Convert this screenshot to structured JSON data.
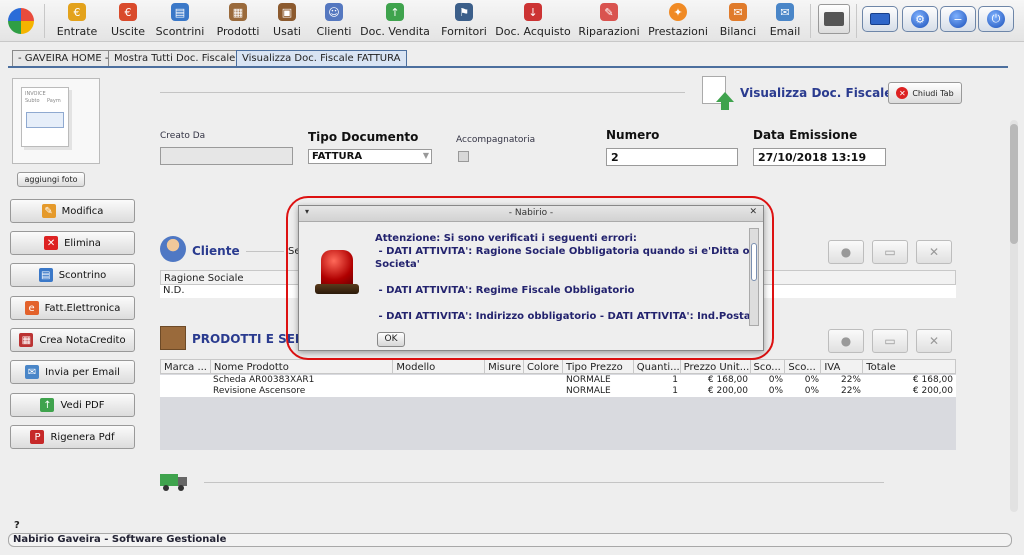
{
  "toolbar": {
    "items": [
      {
        "label": "Entrate"
      },
      {
        "label": "Uscite"
      },
      {
        "label": "Scontrini"
      },
      {
        "label": "Prodotti"
      },
      {
        "label": "Usati"
      },
      {
        "label": "Clienti"
      },
      {
        "label": "Doc. Vendita"
      },
      {
        "label": "Fornitori"
      },
      {
        "label": "Doc. Acquisto"
      },
      {
        "label": "Riparazioni"
      },
      {
        "label": "Prestazioni"
      },
      {
        "label": "Bilanci"
      },
      {
        "label": "Email"
      }
    ],
    "right_buttons": [
      {
        "icon": "keyboard-icon"
      },
      {
        "icon": "settings-icon"
      },
      {
        "icon": "minimize-icon"
      },
      {
        "icon": "power-icon"
      }
    ]
  },
  "tabs": [
    {
      "label": "- GAVEIRA HOME -"
    },
    {
      "label": "Mostra Tutti Doc. Fiscale"
    },
    {
      "label": "Visualizza Doc. Fiscale FATTURA"
    }
  ],
  "header": {
    "title": "Visualizza Doc. Fiscale",
    "close_tab": "Chiudi Tab"
  },
  "photo": {
    "button": "aggiungi foto",
    "doc_lines": [
      "INVOICE",
      "Subto",
      "Paym"
    ]
  },
  "side_buttons": [
    {
      "label": "Modifica"
    },
    {
      "label": "Elimina"
    },
    {
      "label": "Scontrino"
    },
    {
      "label": "Fatt.Elettronica"
    },
    {
      "label": "Crea NotaCredito"
    },
    {
      "label": "Invia per Email"
    },
    {
      "label": "Vedi PDF"
    },
    {
      "label": "Rigenera Pdf"
    }
  ],
  "form": {
    "creato_da_label": "Creato Da",
    "creato_da_value": "",
    "tipo_label": "Tipo Documento",
    "tipo_value": "FATTURA",
    "accompagnatoria_label": "Accompagnatoria",
    "numero_label": "Numero",
    "numero_value": "2",
    "data_label": "Data Emissione",
    "data_value": "27/10/2018 13:19"
  },
  "cliente": {
    "title": "Cliente",
    "partial_label": "Se",
    "columns": [
      "Ragione Sociale"
    ],
    "rows": [
      [
        "N.D."
      ]
    ]
  },
  "prodotti": {
    "title": "PRODOTTI E SERVI",
    "columns": [
      "Marca ...",
      "Nome Prodotto",
      "Modello",
      "Misure",
      "Colore",
      "Tipo Prezzo",
      "Quanti...",
      "Prezzo Unit...",
      "Sco...",
      "Sco...",
      "IVA",
      "Totale"
    ],
    "rows": [
      [
        "",
        "Scheda AR00383XAR1",
        "",
        "",
        "",
        "NORMALE",
        "1",
        "€ 168,00",
        "0%",
        "0%",
        "22%",
        "€ 168,00"
      ],
      [
        "",
        "Revisione Ascensore",
        "",
        "",
        "",
        "NORMALE",
        "1",
        "€ 200,00",
        "0%",
        "0%",
        "22%",
        "€ 200,00"
      ]
    ]
  },
  "dialog": {
    "title": "- Nabirio -",
    "lines": [
      "Attenzione: Si sono verificati i seguenti errori:",
      " - DATI ATTIVITA': Ragione Sociale Obbligatoria quando si e'Ditta o",
      "Societa'",
      "",
      " - DATI ATTIVITA': Regime Fiscale Obbligatorio",
      "",
      " - DATI ATTIVITA': Indirizzo obbligatorio - DATI ATTIVITA': Ind.Posta"
    ],
    "ok": "OK"
  },
  "status": {
    "question": "?",
    "text": "Nabirio Gaveira - Software Gestionale"
  },
  "colors": {
    "accent": "#2a3b8f",
    "tab_active": "#d9e4f3",
    "alert_ring": "#dd1111"
  }
}
